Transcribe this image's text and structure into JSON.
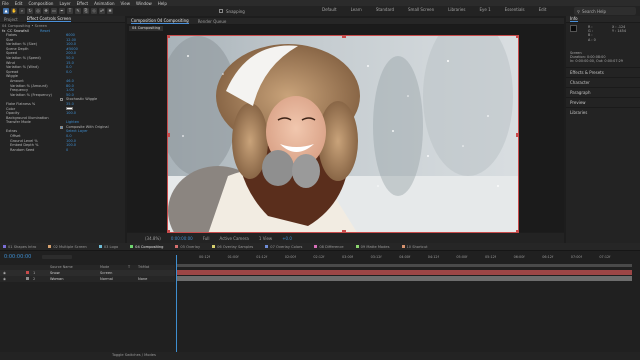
{
  "menu": [
    "File",
    "Edit",
    "Composition",
    "Layer",
    "Effect",
    "Animation",
    "View",
    "Window",
    "Help"
  ],
  "toolbar": {
    "tools": [
      "selection",
      "hand",
      "zoom",
      "rotate",
      "camera",
      "pan-behind",
      "rectangle",
      "pen",
      "type",
      "brush",
      "clone",
      "eraser",
      "roto",
      "puppet"
    ],
    "snapping_label": "Snapping",
    "workspaces": [
      "Default",
      "Learn",
      "Standard",
      "Small Screen",
      "Libraries",
      "Eye 1",
      "Essentials",
      "Edit"
    ],
    "search_placeholder": "Search Help"
  },
  "left_panel": {
    "tabs": [
      "Project",
      "Effect Controls Screen"
    ],
    "breadcrumb": "04 Compositing • Screen",
    "effect_name": "CC Snowfall",
    "reset_label": "Reset",
    "params": [
      {
        "label": "Flakes",
        "value": "6000"
      },
      {
        "label": "Size",
        "value": "12.00"
      },
      {
        "label": "Variation % (Size)",
        "value": "100.0"
      },
      {
        "label": "Scene Depth",
        "value": "#5000"
      },
      {
        "label": "Speed",
        "value": "200.0"
      },
      {
        "label": "Variation % (Speed)",
        "value": "50.0"
      },
      {
        "label": "Wind",
        "value": "15.0"
      },
      {
        "label": "Variation % (Wind)",
        "value": "0.0"
      },
      {
        "label": "Spread",
        "value": "0.0"
      },
      {
        "label": "Wiggle",
        "value": ""
      },
      {
        "label": "Amount",
        "value": "46.0"
      },
      {
        "label": "Variation % (Amount)",
        "value": "80.0"
      },
      {
        "label": "Frequency",
        "value": "1.00"
      },
      {
        "label": "Variation % (Frequency)",
        "value": "50.0"
      },
      {
        "label": "",
        "value": ""
      },
      {
        "label": "Flake Flatness %",
        "value": "35.0"
      },
      {
        "label": "Color",
        "value": ""
      },
      {
        "label": "Opacity",
        "value": "100.0"
      },
      {
        "label": "Background Illumination",
        "value": ""
      },
      {
        "label": "Transfer Mode",
        "value": "Lighten"
      },
      {
        "label": "",
        "value": ""
      },
      {
        "label": "Extras",
        "value": ""
      },
      {
        "label": "Offset",
        "value": "0.0"
      },
      {
        "label": "Ground Level %",
        "value": "100.0"
      },
      {
        "label": "Embed Depth %",
        "value": "100.0"
      },
      {
        "label": "Random Seed",
        "value": "0"
      }
    ],
    "stochastic_wiggle_label": "Stochastic Wiggle",
    "composite_label": "Composite With Original",
    "select_layer_label": "Select Layer"
  },
  "viewer": {
    "tabs": [
      "Composition 04 Compositing",
      "Render Queue"
    ],
    "comp_tab_label": "04 Compositing",
    "zoom": "(34.8%)",
    "timecode": "0:00:00:00",
    "resolution": "Full",
    "camera": "Active Camera",
    "views": "1 View",
    "exposure": "+0.0"
  },
  "right_panel": {
    "tab": "Info",
    "info_lines": [
      "R :",
      "G :",
      "B :",
      "A : 0"
    ],
    "coords": [
      "X : -124",
      "Y : 1454"
    ],
    "info_details": [
      "Screen",
      "Duration: 0:00:08:00",
      "In: 0:00:00:00, Out: 0:00:07:29"
    ],
    "sections": [
      "Effects & Presets",
      "Character",
      "Paragraph",
      "Preview",
      "Libraries"
    ]
  },
  "timeline": {
    "tabs": [
      {
        "label": "01 Shapes Intro",
        "color": "#7b6fd6"
      },
      {
        "label": "02 Multiple Screen",
        "color": "#d6a16f"
      },
      {
        "label": "03 Logo",
        "color": "#6fbcd6"
      },
      {
        "label": "04 Compositing",
        "color": "#6fd66f"
      },
      {
        "label": "05 Overlay",
        "color": "#d66f6f"
      },
      {
        "label": "06 Overlay Samples",
        "color": "#d6d06f"
      },
      {
        "label": "07 Overlay Colors",
        "color": "#6f8cd6"
      },
      {
        "label": "08 Difference",
        "color": "#d66fb8"
      },
      {
        "label": "09 Matte Modes",
        "color": "#8cd66f"
      },
      {
        "label": "10 Shortcut",
        "color": "#d6936f"
      }
    ],
    "timecode": "0:00:00:00",
    "columns": [
      "Source Name",
      "Mode",
      "T",
      "TrkMat"
    ],
    "layers": [
      {
        "num": "1",
        "name": "Snow",
        "mode": "Screen",
        "trkmat": "",
        "color": "#c84b4b"
      },
      {
        "num": "2",
        "name": "Woman",
        "mode": "Normal",
        "trkmat": "None",
        "color": "#8e8e8e"
      }
    ],
    "ruler": [
      "00:12f",
      "01:00f",
      "01:12f",
      "02:00f",
      "02:12f",
      "03:00f",
      "03:12f",
      "04:00f",
      "04:12f",
      "05:00f",
      "05:12f",
      "06:00f",
      "06:12f",
      "07:00f",
      "07:12f"
    ],
    "footer": "Toggle Switches / Modes"
  },
  "colors": {
    "accent": "#3e8ed0",
    "layer_red": "#c84b4b",
    "label_green": "#6fd66f"
  }
}
